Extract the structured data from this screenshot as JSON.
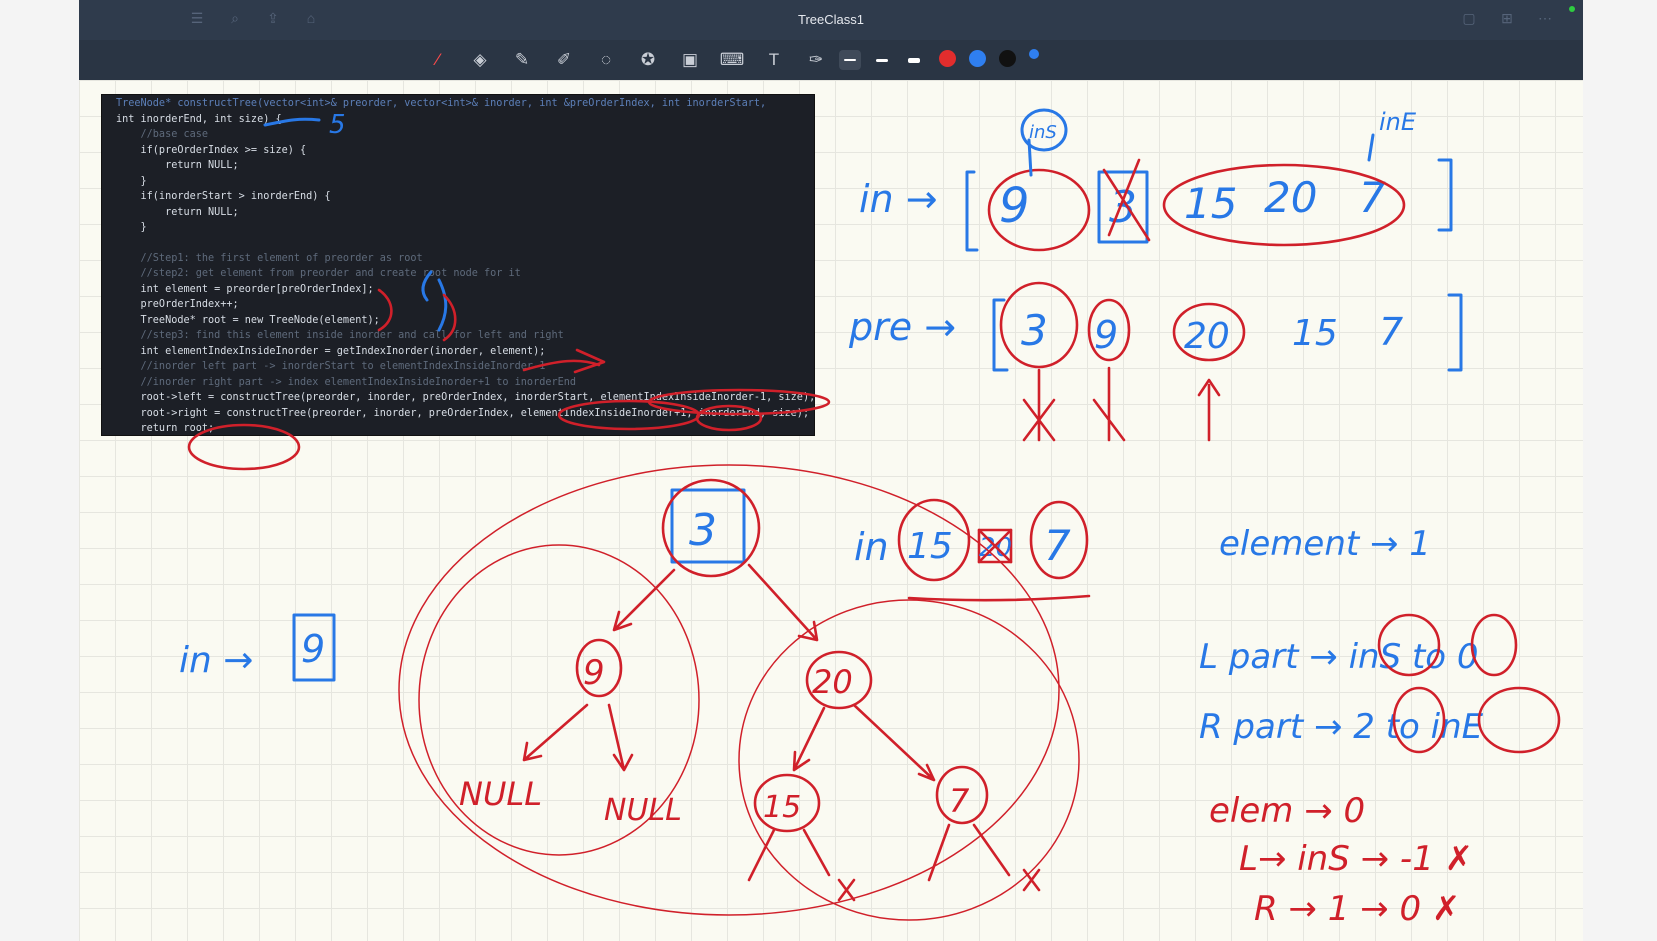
{
  "window": {
    "title": "TreeClass1"
  },
  "toolbar": {
    "left_icons": [
      "sidebar-icon",
      "search-icon",
      "share-icon",
      "bookmark-icon"
    ],
    "tools": [
      "laser-pointer-icon",
      "eraser-icon",
      "pencil-icon",
      "highlighter-icon",
      "lasso-icon",
      "shapes-icon",
      "image-icon",
      "keyboard-icon",
      "text-icon",
      "more-tools-icon"
    ],
    "colors": {
      "red": "#e22d2d",
      "blue": "#2f7ff0",
      "black": "#111111",
      "accent": "#2f7ff0"
    }
  },
  "code": {
    "lines": [
      "TreeNode* constructTree(vector<int>& preorder, vector<int>& inorder, int &preOrderIndex, int inorderStart,",
      "int inorderEnd, int size) {",
      "    //base case",
      "    if(preOrderIndex >= size) {",
      "        return NULL;",
      "    }",
      "    if(inorderStart > inorderEnd) {",
      "        return NULL;",
      "    }",
      "",
      "    //Step1: the first element of preorder as root",
      "    //step2: get element from preorder and create root node for it",
      "    int element = preorder[preOrderIndex];",
      "    preOrderIndex++;",
      "    TreeNode* root = new TreeNode(element);",
      "    //step3: find this element inside inorder and call for left and right",
      "    int elementIndexInsideInorder = getIndexInorder(inorder, element);",
      "    //inorder left part -> inorderStart to elementIndexInsideInorder-1",
      "    //inorder right part -> index elementIndexInsideInorder+1 to inorderEnd",
      "    root->left = constructTree(preorder, inorder, preOrderIndex, inorderStart, elementIndexInsideInorder-1, size);",
      "    root->right = constructTree(preorder, inorder, preOrderIndex, elementIndexInsideInorder+1, inorderEnd, size);",
      "    return root;"
    ]
  },
  "notes": {
    "in_label": "in →",
    "in_values": [
      "9",
      "3",
      "15",
      "20",
      "7"
    ],
    "pre_label": "pre →",
    "pre_values": [
      "3",
      "9",
      "20",
      "15",
      "7"
    ],
    "ins_tag": "inS",
    "ine_tag": "inE",
    "in_right_label": "in",
    "in_right_values": [
      "15",
      "20",
      "7"
    ],
    "element_note": "element → 1",
    "lpart": "L part → inS to 0",
    "rpart": "R part → 2 to inE",
    "elem0": "elem → 0",
    "l_line": "L→ inS → -1 ✗",
    "r_line": "R → 1 → 0 ✗",
    "in9": "in →",
    "in9_val": "9",
    "size_val": "5",
    "tree_root": "3",
    "tree_nodes": [
      "9",
      "20",
      "15",
      "7"
    ],
    "null_left": "NULL",
    "null_right": "NULL"
  }
}
